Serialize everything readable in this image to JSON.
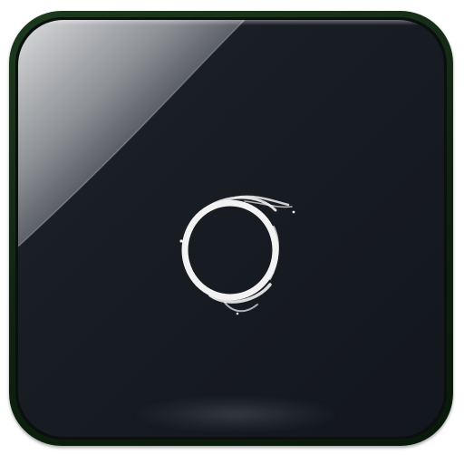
{
  "app_icon": {
    "name": "ring-app-icon",
    "icon_semantic": "brush-ring-icon",
    "colors": {
      "frame": "#0e220f",
      "face": "#171b22",
      "ring": "#f2f2f2",
      "gloss": "#ffffff"
    }
  }
}
